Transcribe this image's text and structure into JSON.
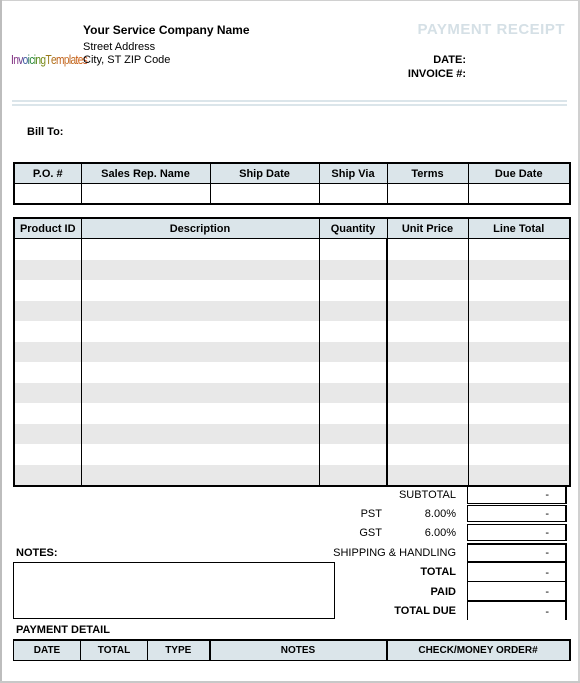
{
  "header": {
    "logo_text": "InvoicingTemplates",
    "company_name": "Your Service Company Name",
    "street_address": "Street Address",
    "city_line": "City, ST  ZIP Code",
    "document_title": "PAYMENT RECEIPT",
    "date_label": "DATE:",
    "invoice_label": "INVOICE #:"
  },
  "bill_to": {
    "label": "Bill To:"
  },
  "order_info": {
    "columns": [
      "P.O. #",
      "Sales Rep. Name",
      "Ship Date",
      "Ship Via",
      "Terms",
      "Due Date"
    ],
    "row": [
      "",
      "",
      "",
      "",
      "",
      ""
    ]
  },
  "items": {
    "columns": [
      "Product ID",
      "Description",
      "Quantity",
      "Unit Price",
      "Line Total"
    ],
    "row_count": 12
  },
  "totals": {
    "subtotal": {
      "label": "SUBTOTAL",
      "value": "-"
    },
    "pst": {
      "label": "PST",
      "rate": "8.00%",
      "value": "-"
    },
    "gst": {
      "label": "GST",
      "rate": "6.00%",
      "value": "-"
    },
    "shipping": {
      "label": "SHIPPING & HANDLING",
      "value": "-"
    },
    "total": {
      "label": "TOTAL",
      "value": "-"
    },
    "paid": {
      "label": "PAID",
      "value": "-"
    },
    "total_due": {
      "label": "TOTAL DUE",
      "value": "-"
    }
  },
  "notes": {
    "label": "NOTES:",
    "value": ""
  },
  "payment_detail": {
    "label": "PAYMENT DETAIL",
    "columns": [
      "DATE",
      "TOTAL",
      "TYPE",
      "NOTES",
      "CHECK/MONEY ORDER#"
    ]
  },
  "colors": {
    "header_fill": "#dbe5ea",
    "alt_row_fill": "#e8e8e8",
    "title_color": "#d5e0e6"
  }
}
